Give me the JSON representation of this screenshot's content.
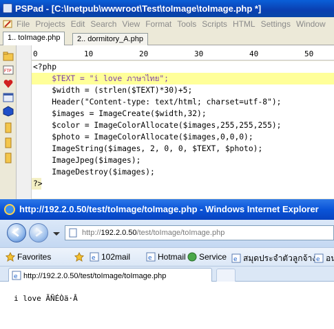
{
  "pspad": {
    "title": "PSPad - [C:\\Inetpub\\wwwroot\\Test\\toImage\\toImage.php *]",
    "menu": [
      "File",
      "Projects",
      "Edit",
      "Search",
      "View",
      "Format",
      "Tools",
      "Scripts",
      "HTML",
      "Settings",
      "Window"
    ],
    "tabs": [
      "1.. toImage.php",
      "2.. dormitory_A.php"
    ],
    "ruler": [
      "0",
      "10",
      "20",
      "30",
      "40",
      "50"
    ],
    "code": [
      "<?php",
      "    $TEXT = \"i love ภาษาไทย\";",
      "    $width = (strlen($TEXT)*30)+5;",
      "    Header(\"Content-type: text/html; charset=utf-8\");",
      "    $images = ImageCreate($width,32);",
      "    $color = ImageColorAllocate($images,255,255,255);",
      "    $photo = ImageColorAllocate($images,0,0,0);",
      "    ImageString($images, 2, 0, 0, $TEXT, $photo);",
      "    ImageJpeg($images);",
      "    ImageDestroy($images);",
      "",
      "?>"
    ]
  },
  "ie": {
    "title": "http://192.2.0.50/test/toImage/toImage.php - Windows Internet Explorer",
    "address_prefix": "http://",
    "address_host": "192.2.0.50",
    "address_path": "/test/toImage/toImage.php",
    "favorites_label": "Favorites",
    "favorites": [
      "102mail",
      "Hotmail",
      "Service",
      "สมุดประจำตัวลูกจ้าง",
      "อน"
    ],
    "tab_title": "http://192.2.0.50/test/toImage/toImage.php",
    "page_output": "i love ÃÑÉÒä·Â"
  },
  "colors": {
    "title_bar": "#0a54d8",
    "highlight_line": "#ffff99",
    "variable": "#7b3fa8",
    "string": "#1a10b8"
  }
}
